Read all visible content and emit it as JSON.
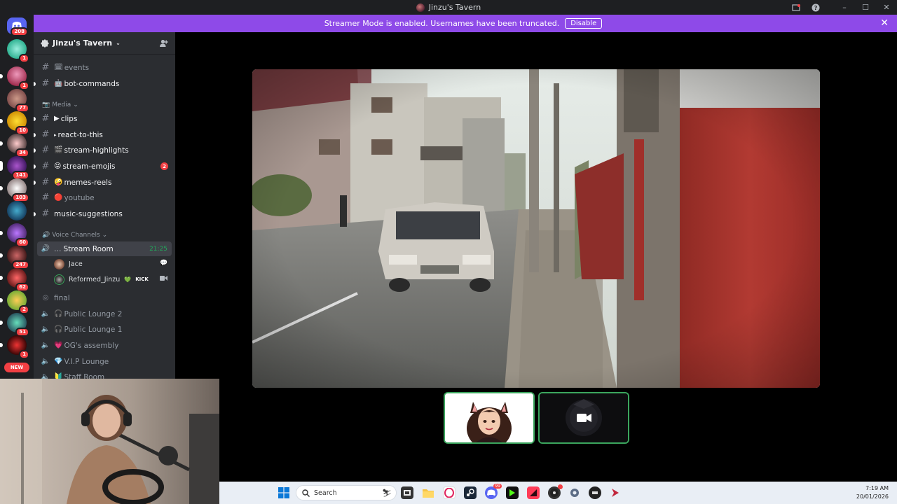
{
  "window": {
    "title": "Jinzu's Tavern"
  },
  "banner": {
    "message": "Streamer Mode is enabled. Usernames have been truncated.",
    "disable_label": "Disable"
  },
  "rail": {
    "badges": [
      "208",
      "1",
      "1",
      "77",
      "10",
      "34",
      "141",
      "103",
      "60",
      "247",
      "62",
      "2",
      "51",
      "1"
    ],
    "new_label": "NEW"
  },
  "server": {
    "name": "Jinzu's Tavern"
  },
  "channels": {
    "events": "events",
    "events_emoji": "🗓",
    "bot_commands": "bot-commands",
    "media_category": "Media",
    "clips": "clips",
    "react": "react-to-this",
    "highlights": "stream-highlights",
    "emojis": "stream-emojis",
    "emojis_badge": "2",
    "memes": "memes-reels",
    "youtube": "youtube",
    "music": "music-suggestions",
    "voice_category": "Voice Channels",
    "stream_room": "Stream Room",
    "stream_room_time": "21:25",
    "member1": "Jace",
    "member2": "Reformed_Jinzu",
    "member2_tag": "KICK",
    "final": "final",
    "lounge2": "Public Lounge 2",
    "lounge1": "Public Lounge 1",
    "og": "OG's assembly",
    "vip": "V.I.P Lounge",
    "staff": "Staff Room"
  },
  "taskbar": {
    "search_placeholder": "Search",
    "time": "7:19 AM",
    "date": "20/01/2026",
    "discord_badge": "99"
  },
  "colors": {
    "banner": "#8e4ae8",
    "sidebar": "#2b2d31",
    "rail": "#1e1f22",
    "speaking": "#3ba55d",
    "badge": "#f23f43"
  }
}
